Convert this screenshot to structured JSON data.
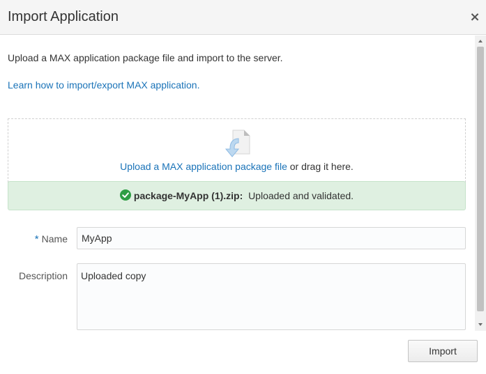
{
  "dialog": {
    "title": "Import Application",
    "close_glyph": "×"
  },
  "intro_text": "Upload a MAX application package file and import to the server.",
  "learn_link": "Learn how to import/export MAX application.",
  "dropzone": {
    "icon": "file-download-icon",
    "link_text": "Upload a MAX application package file",
    "suffix_text": " or drag it here."
  },
  "upload_status": {
    "icon": "check-circle-icon",
    "file_name": "package-MyApp (1).zip:",
    "message": "Uploaded and validated.",
    "color": "#dff0e1"
  },
  "form": {
    "required_marker": "*",
    "name_label": "Name",
    "name_value": "MyApp",
    "description_label": "Description",
    "description_value": "Uploaded copy"
  },
  "footer": {
    "import_label": "Import"
  },
  "colors": {
    "link": "#1a73b8",
    "success_icon": "#2e9e44"
  }
}
